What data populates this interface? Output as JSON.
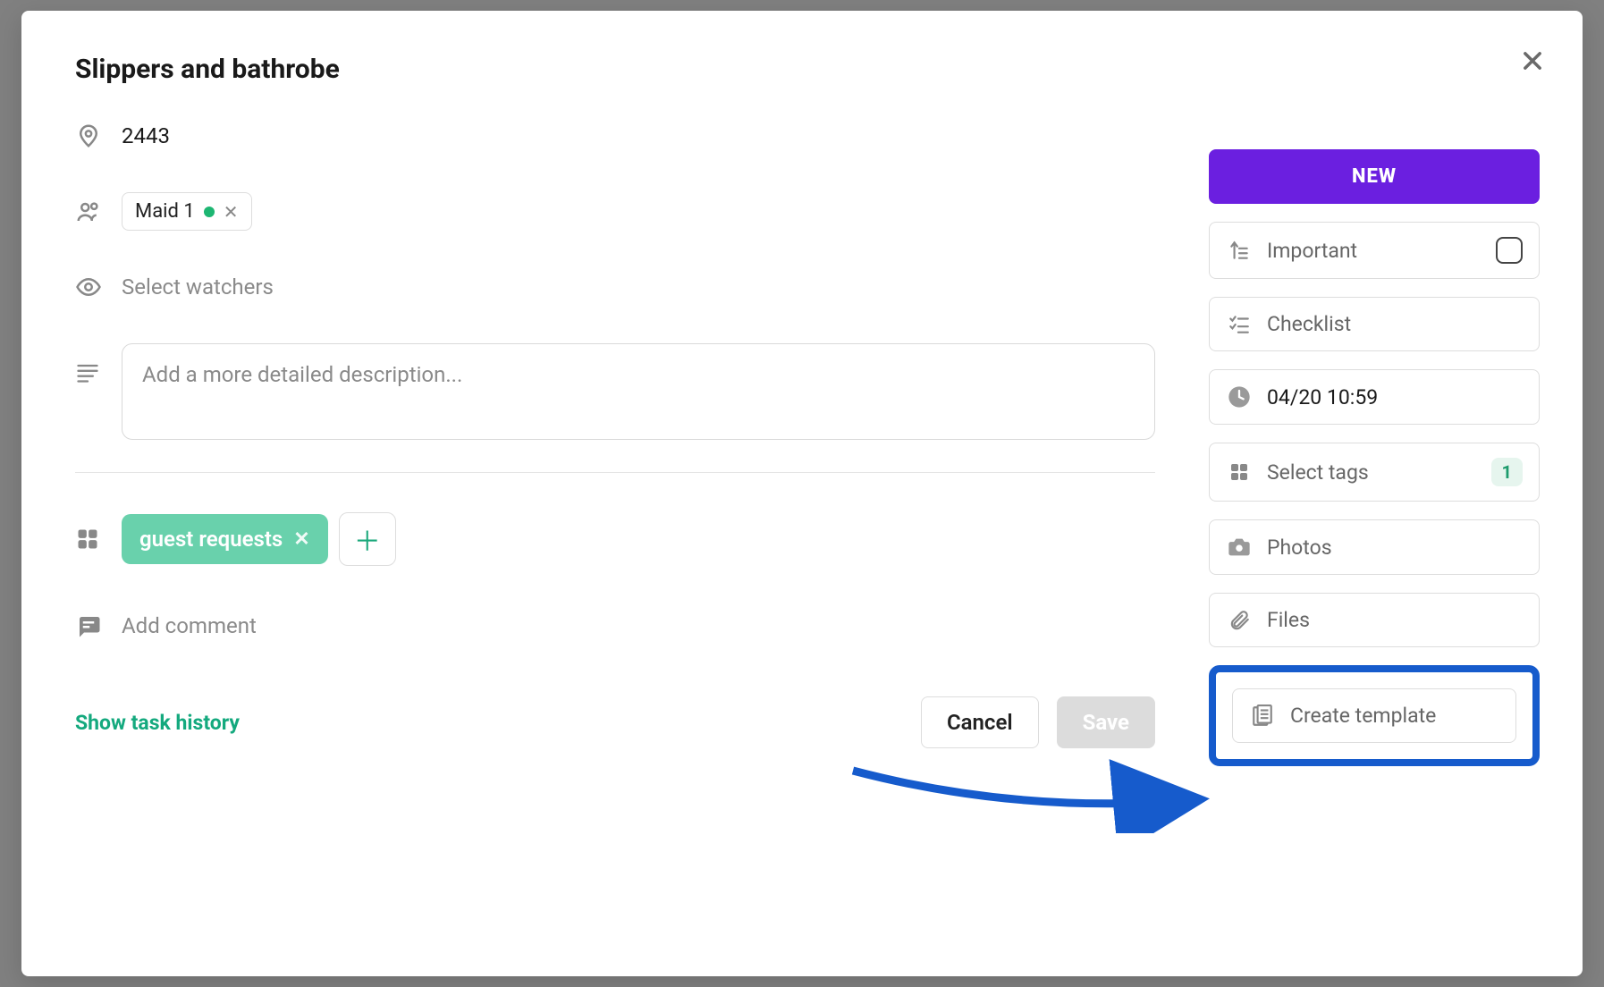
{
  "title": "Slippers and bathrobe",
  "location": "2443",
  "assignee": {
    "name": "Maid 1"
  },
  "watchers_placeholder": "Select watchers",
  "description_placeholder": "Add a more detailed description...",
  "tags": {
    "primary": "guest requests"
  },
  "comment_placeholder": "Add comment",
  "history_link": "Show task history",
  "buttons": {
    "cancel": "Cancel",
    "save": "Save"
  },
  "sidebar": {
    "new": "NEW",
    "important": "Important",
    "checklist": "Checklist",
    "datetime": "04/20 10:59",
    "select_tags": "Select tags",
    "tag_count": "1",
    "photos": "Photos",
    "files": "Files",
    "create_template": "Create template"
  }
}
